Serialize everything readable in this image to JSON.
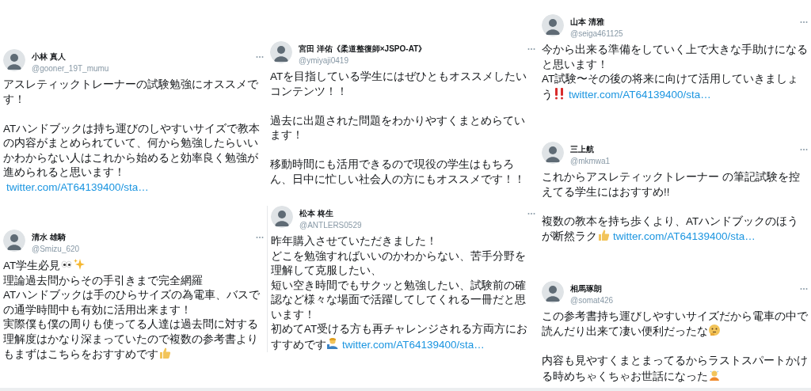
{
  "columns": [
    {
      "tweets": [
        {
          "name": "小林 真人",
          "handle": "@gooner_19T_mumu",
          "paragraphs": [
            [
              [
                {
                  "kind": "text",
                  "text": "アスレティックトレーナーの試験勉強にオススメです！"
                }
              ]
            ],
            [
              [
                {
                  "kind": "text",
                  "text": "ATハンドブックは持ち運びのしやすいサイズで教本の内容がまとめられていて、何から勉強したらいいかわからない人はこれから始めると効率良く勉強が進められると思います！"
                },
                {
                  "kind": "link",
                  "text": "twitter.com/AT64139400/sta…"
                }
              ]
            ]
          ]
        },
        {
          "name": "清水 雄騎",
          "handle": "@Smizu_620",
          "paragraphs": [
            [
              [
                {
                  "kind": "text",
                  "text": "AT学生必見"
                },
                {
                  "kind": "eyes"
                },
                {
                  "kind": "sparkles"
                }
              ],
              [
                {
                  "kind": "text",
                  "text": "理論過去問からその手引きまで完全網羅"
                }
              ],
              [
                {
                  "kind": "text",
                  "text": "ATハンドブックは手のひらサイズの為電車、バスでの通学時間中も有効に活用出来ます！"
                }
              ],
              [
                {
                  "kind": "text",
                  "text": "実際僕も僕の周りも使ってる人達は過去問に対する理解度はかなり深まっていたので複数の参考書よりもまずはこちらをおすすめです"
                },
                {
                  "kind": "thumbs-up"
                }
              ]
            ]
          ]
        }
      ]
    },
    {
      "tweets": [
        {
          "name": "宮田 洋佑《柔道整復師×JSPO-AT》",
          "handle": "@ymiyaji0419",
          "paragraphs": [
            [
              [
                {
                  "kind": "text",
                  "text": "ATを目指している学生にはぜひともオススメしたいコンテンツ！！"
                }
              ]
            ],
            [
              [
                {
                  "kind": "text",
                  "text": "過去に出題された問題をわかりやすくまとめらています！"
                }
              ]
            ],
            [
              [
                {
                  "kind": "text",
                  "text": "移動時間にも活用できるので現役の学生はもちろん、日中に忙しい社会人の方にもオススメです！！"
                }
              ]
            ]
          ]
        },
        {
          "name": "松本 柊生",
          "handle": "@ANTLERS0529",
          "paragraphs": [
            [
              [
                {
                  "kind": "text",
                  "text": "昨年購入させていただきました！"
                }
              ],
              [
                {
                  "kind": "text",
                  "text": "どこを勉強すればいいのかわからない、苦手分野を理解して克服したい、"
                }
              ],
              [
                {
                  "kind": "text",
                  "text": "短い空き時間でもサクッと勉強したい、試験前の確認など様々な場面で活躍してしてくれる一冊だと思います！"
                }
              ],
              [
                {
                  "kind": "text",
                  "text": "初めてAT受ける方も再チャレンジされる方両方におすすめです"
                },
                {
                  "kind": "person"
                },
                {
                  "kind": "link",
                  "text": "twitter.com/AT64139400/sta…"
                }
              ]
            ]
          ]
        }
      ]
    },
    {
      "tweets": [
        {
          "name": "山本 清雅",
          "handle": "@seiga461125",
          "paragraphs": [
            [
              [
                {
                  "kind": "text",
                  "text": "今から出来る準備をしていく上で大きな手助けになると思います！"
                }
              ],
              [
                {
                  "kind": "text",
                  "text": "AT試験〜その後の将来に向けて活用していきましょう"
                },
                {
                  "kind": "double-exclamation"
                },
                {
                  "kind": "link",
                  "text": "twitter.com/AT64139400/sta…"
                }
              ]
            ]
          ]
        },
        {
          "name": "三上航",
          "handle": "@mkmwa1",
          "paragraphs": [
            [
              [
                {
                  "kind": "text",
                  "text": "これからアスレティックトレーナー の筆記試験を控えてる学生にはおすすめ!!"
                }
              ]
            ],
            [
              [
                {
                  "kind": "text",
                  "text": "複数の教本を持ち歩くより、ATハンドブックのほうが断然ラク"
                },
                {
                  "kind": "thumbs-up"
                },
                {
                  "kind": "link",
                  "text": "twitter.com/AT64139400/sta…"
                }
              ]
            ]
          ]
        },
        {
          "name": "相馬琢朗",
          "handle": "@somat426",
          "paragraphs": [
            [
              [
                {
                  "kind": "text",
                  "text": "この参考書持ち運びしやすいサイズだから電車の中で読んだり出来て凄い便利だったな"
                },
                {
                  "kind": "thinking"
                }
              ]
            ],
            [
              [
                {
                  "kind": "text",
                  "text": "内容も見やすくまとまってるからラストスパートかける時めちゃくちゃお世話になった"
                },
                {
                  "kind": "bow"
                }
              ]
            ]
          ]
        }
      ]
    }
  ]
}
